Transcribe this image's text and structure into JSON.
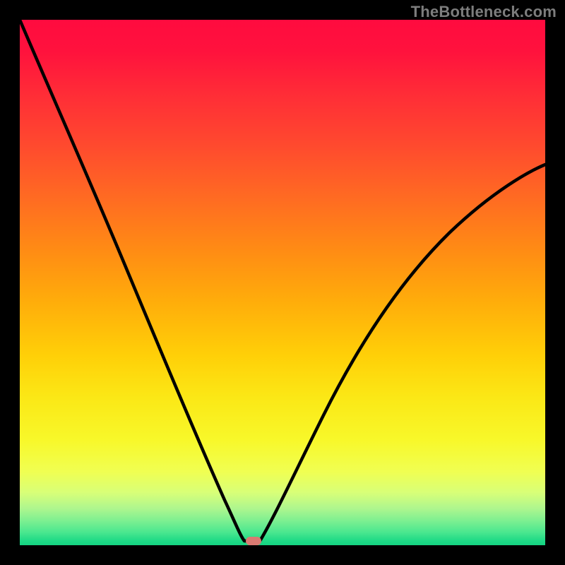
{
  "watermark": "TheBottleneck.com",
  "colors": {
    "background": "#000000",
    "gradient_top": "#ff0b3f",
    "gradient_bottom": "#14d382",
    "curve": "#000000",
    "marker": "#d97a72"
  },
  "chart_data": {
    "type": "line",
    "title": "",
    "xlabel": "",
    "ylabel": "",
    "xlim": [
      0,
      1
    ],
    "ylim": [
      0,
      1
    ],
    "grid": false,
    "legend": false,
    "annotations": [
      {
        "text": "TheBottleneck.com",
        "position": "top-right"
      }
    ],
    "minimum": {
      "x": 0.445,
      "y": 0.0
    },
    "marker": {
      "x": 0.445,
      "y": 0.008,
      "shape": "rounded-rect"
    },
    "series": [
      {
        "name": "curve",
        "x": [
          0.0,
          0.04,
          0.08,
          0.12,
          0.16,
          0.2,
          0.24,
          0.28,
          0.32,
          0.36,
          0.4,
          0.42,
          0.445,
          0.48,
          0.52,
          0.56,
          0.6,
          0.64,
          0.7,
          0.78,
          0.86,
          0.94,
          1.0
        ],
        "y": [
          1.0,
          0.91,
          0.81,
          0.72,
          0.62,
          0.52,
          0.42,
          0.32,
          0.22,
          0.13,
          0.05,
          0.02,
          0.0,
          0.05,
          0.11,
          0.18,
          0.25,
          0.31,
          0.39,
          0.49,
          0.56,
          0.63,
          0.67
        ]
      }
    ]
  }
}
